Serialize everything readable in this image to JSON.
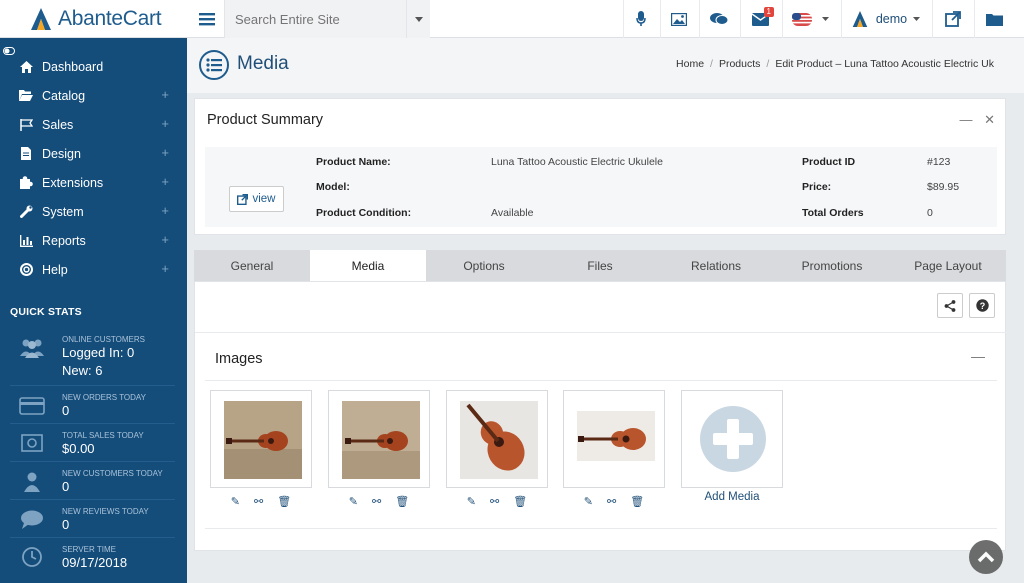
{
  "brand": {
    "name": "AbanteCart",
    "accent": "#1f5c8e",
    "sidebar_bg": "#144c7a"
  },
  "header": {
    "search_placeholder": "Search Entire Site",
    "messages_badge": "1",
    "user": "demo"
  },
  "sidebar": {
    "items": [
      {
        "label": "Dashboard",
        "icon": "home-icon",
        "expandable": false
      },
      {
        "label": "Catalog",
        "icon": "folder-open-icon",
        "expandable": true
      },
      {
        "label": "Sales",
        "icon": "flag-icon",
        "expandable": true
      },
      {
        "label": "Design",
        "icon": "file-icon",
        "expandable": true
      },
      {
        "label": "Extensions",
        "icon": "puzzle-icon",
        "expandable": true
      },
      {
        "label": "System",
        "icon": "wrench-icon",
        "expandable": true
      },
      {
        "label": "Reports",
        "icon": "bar-chart-icon",
        "expandable": true
      },
      {
        "label": "Help",
        "icon": "lifebuoy-icon",
        "expandable": true
      }
    ],
    "quick_stats_title": "QUICK STATS",
    "quick_stats": [
      {
        "label": "ONLINE CUSTOMERS",
        "value": "Logged In: 0",
        "value2": "New: 6",
        "icon": "users-icon"
      },
      {
        "label": "NEW ORDERS TODAY",
        "value": "0",
        "icon": "credit-card-icon"
      },
      {
        "label": "TOTAL SALES TODAY",
        "value": "$0.00",
        "icon": "money-icon"
      },
      {
        "label": "NEW CUSTOMERS TODAY",
        "value": "0",
        "icon": "user-icon"
      },
      {
        "label": "NEW REVIEWS TODAY",
        "value": "0",
        "icon": "comment-icon"
      },
      {
        "label": "SERVER TIME",
        "value": "09/17/2018",
        "icon": "clock-icon"
      }
    ]
  },
  "page": {
    "title": "Media",
    "breadcrumb": [
      "Home",
      "Products",
      "Edit  Product – Luna Tattoo Acoustic Electric Uk"
    ]
  },
  "summary": {
    "title": "Product Summary",
    "view_label": "view",
    "fields": {
      "name_label": "Product Name:",
      "name_value": "Luna Tattoo Acoustic Electric Ukulele",
      "model_label": "Model:",
      "model_value": "",
      "condition_label": "Product Condition:",
      "condition_value": "Available",
      "id_label": "Product ID",
      "id_value": "#123",
      "price_label": "Price:",
      "price_value": "$89.95",
      "orders_label": "Total Orders",
      "orders_value": "0"
    }
  },
  "tabs": [
    {
      "label": "General",
      "active": false
    },
    {
      "label": "Media",
      "active": true
    },
    {
      "label": "Options",
      "active": false
    },
    {
      "label": "Files",
      "active": false
    },
    {
      "label": "Relations",
      "active": false
    },
    {
      "label": "Promotions",
      "active": false
    },
    {
      "label": "Page Layout",
      "active": false
    }
  ],
  "images": {
    "title": "Images",
    "add_media_label": "Add Media",
    "count": 4
  }
}
